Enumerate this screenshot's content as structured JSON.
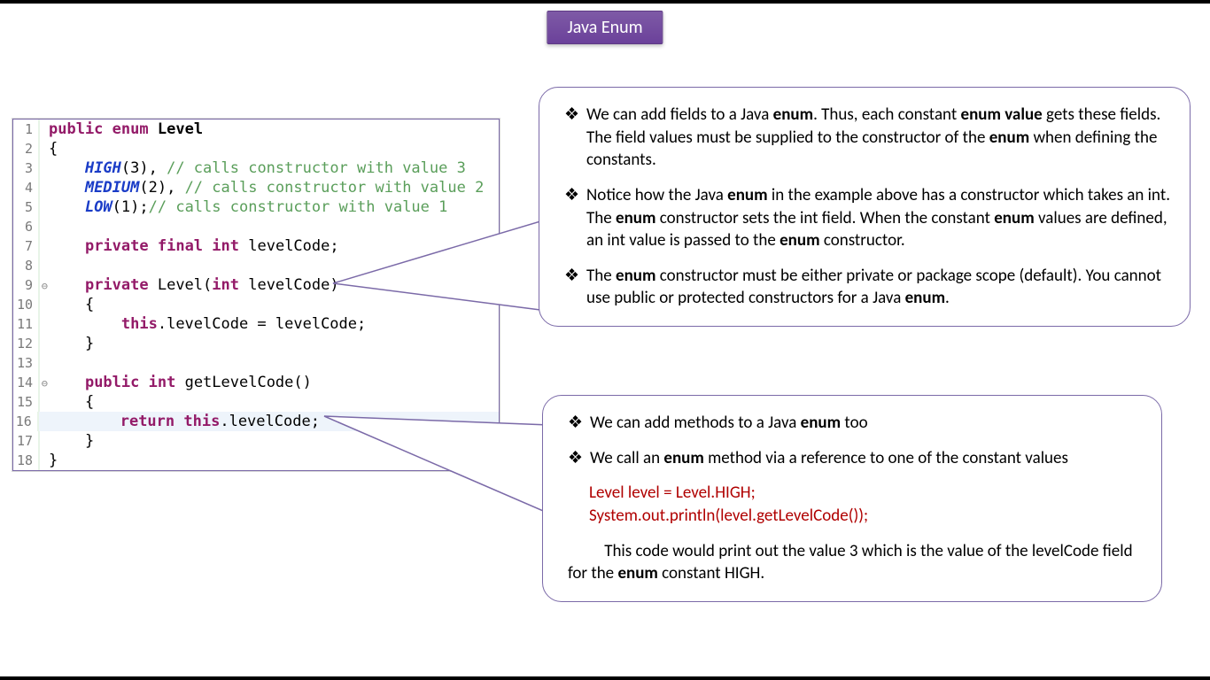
{
  "title": "Java Enum",
  "code": {
    "lines": [
      {
        "n": "1",
        "html": "<span class='kw'>public</span> <span class='kw'>enum</span> <span class='cname'>Level</span>"
      },
      {
        "n": "2",
        "html": "{"
      },
      {
        "n": "3",
        "html": "    <span class='const'>HIGH</span>(3), <span class='comment'>// calls constructor with value 3</span>"
      },
      {
        "n": "4",
        "html": "    <span class='const'>MEDIUM</span>(2), <span class='comment'>// calls constructor with value 2</span>"
      },
      {
        "n": "5",
        "html": "    <span class='const'>LOW</span>(1);<span class='comment'>// calls constructor with value 1</span>"
      },
      {
        "n": "6",
        "html": ""
      },
      {
        "n": "7",
        "html": "    <span class='kw'>private</span> <span class='kw'>final</span> <span class='ptype'>int</span> levelCode;"
      },
      {
        "n": "8",
        "html": ""
      },
      {
        "n": "9",
        "marker": true,
        "html": "    <span class='kw'>private</span> Level(<span class='ptype'>int</span> levelCode)"
      },
      {
        "n": "10",
        "html": "    {"
      },
      {
        "n": "11",
        "html": "        <span class='thisk'>this</span>.levelCode = levelCode;"
      },
      {
        "n": "12",
        "html": "    }"
      },
      {
        "n": "13",
        "html": ""
      },
      {
        "n": "14",
        "marker": true,
        "html": "    <span class='kw'>public</span> <span class='ptype'>int</span> getLevelCode()"
      },
      {
        "n": "15",
        "html": "    {"
      },
      {
        "n": "16",
        "hl": true,
        "html": "        <span class='kw2'>return</span> <span class='thisk'>this</span>.levelCode;"
      },
      {
        "n": "17",
        "html": "    }"
      },
      {
        "n": "18",
        "html": "}"
      }
    ]
  },
  "callout1": {
    "p1a": "We can add fields to a Java ",
    "p1b": ". Thus, each constant ",
    "p1c": " gets these fields. The field values must be supplied to the constructor of the ",
    "p1d": " when defining the constants.",
    "p2a": "Notice how the Java ",
    "p2b": " in the example above has a constructor which takes an int. The ",
    "p2c": " constructor sets the int field. When the constant ",
    "p2d": " values are defined, an int value is passed to the ",
    "p2e": " constructor.",
    "p3a": "The ",
    "p3b": " constructor must be either private or package scope (default). You cannot use public or protected constructors for a Java ",
    "p3c": "."
  },
  "callout2": {
    "l1": "We can add methods to a Java ",
    "l1b": " too",
    "l2a": "We call an ",
    "l2b": " method via a reference to one of the constant values",
    "code1": "Level level = Level.HIGH;",
    "code2": "System.out.println(level.getLevelCode());",
    "l3a": "This code would print out the value 3 which is the value of the levelCode field for the ",
    "l3b": " constant HIGH."
  },
  "bold": {
    "enum": "enum",
    "enumValue": "enum value"
  }
}
